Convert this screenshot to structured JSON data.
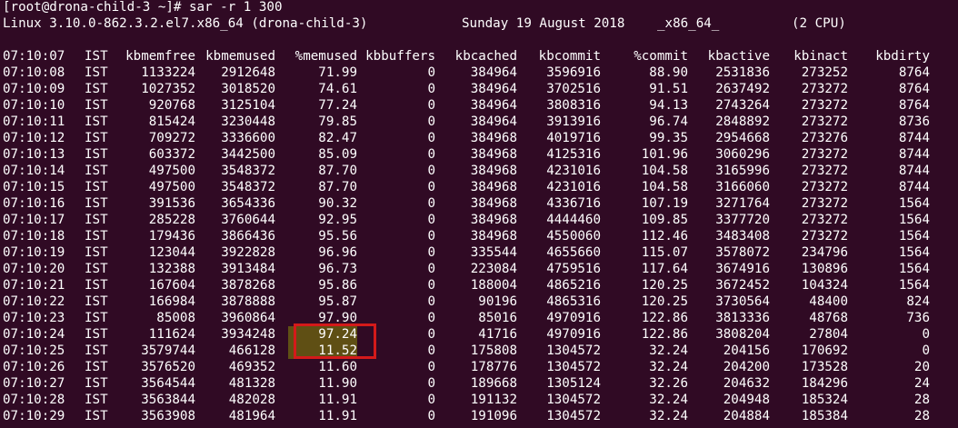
{
  "prompt": "[root@drona-child-3 ~]# sar -r 1 300",
  "sysinfo": {
    "kernel": "Linux 3.10.0-862.3.2.el7.x86_64 (drona-child-3)",
    "date": "Sunday 19 August 2018",
    "arch": "_x86_64_",
    "cpu": "(2 CPU)"
  },
  "header": [
    "07:10:07",
    "IST",
    "kbmemfree",
    "kbmemused",
    "%memused",
    "kbbuffers",
    "kbcached",
    "kbcommit",
    "%commit",
    "kbactive",
    "kbinact",
    "kbdirty"
  ],
  "rows": [
    [
      "07:10:08",
      "IST",
      "1133224",
      "2912648",
      "71.99",
      "0",
      "384964",
      "3596916",
      "88.90",
      "2531836",
      "273252",
      "8764"
    ],
    [
      "07:10:09",
      "IST",
      "1027352",
      "3018520",
      "74.61",
      "0",
      "384964",
      "3702516",
      "91.51",
      "2637492",
      "273272",
      "8764"
    ],
    [
      "07:10:10",
      "IST",
      "920768",
      "3125104",
      "77.24",
      "0",
      "384964",
      "3808316",
      "94.13",
      "2743264",
      "273272",
      "8764"
    ],
    [
      "07:10:11",
      "IST",
      "815424",
      "3230448",
      "79.85",
      "0",
      "384964",
      "3913916",
      "96.74",
      "2848892",
      "273272",
      "8736"
    ],
    [
      "07:10:12",
      "IST",
      "709272",
      "3336600",
      "82.47",
      "0",
      "384968",
      "4019716",
      "99.35",
      "2954668",
      "273276",
      "8744"
    ],
    [
      "07:10:13",
      "IST",
      "603372",
      "3442500",
      "85.09",
      "0",
      "384968",
      "4125316",
      "101.96",
      "3060296",
      "273272",
      "8744"
    ],
    [
      "07:10:14",
      "IST",
      "497500",
      "3548372",
      "87.70",
      "0",
      "384968",
      "4231016",
      "104.58",
      "3165996",
      "273272",
      "8744"
    ],
    [
      "07:10:15",
      "IST",
      "497500",
      "3548372",
      "87.70",
      "0",
      "384968",
      "4231016",
      "104.58",
      "3166060",
      "273272",
      "8744"
    ],
    [
      "07:10:16",
      "IST",
      "391536",
      "3654336",
      "90.32",
      "0",
      "384968",
      "4336716",
      "107.19",
      "3271764",
      "273272",
      "1564"
    ],
    [
      "07:10:17",
      "IST",
      "285228",
      "3760644",
      "92.95",
      "0",
      "384968",
      "4444460",
      "109.85",
      "3377720",
      "273272",
      "1564"
    ],
    [
      "07:10:18",
      "IST",
      "179436",
      "3866436",
      "95.56",
      "0",
      "384968",
      "4550060",
      "112.46",
      "3483408",
      "273272",
      "1564"
    ],
    [
      "07:10:19",
      "IST",
      "123044",
      "3922828",
      "96.96",
      "0",
      "335544",
      "4655660",
      "115.07",
      "3578072",
      "234796",
      "1564"
    ],
    [
      "07:10:20",
      "IST",
      "132388",
      "3913484",
      "96.73",
      "0",
      "223084",
      "4759516",
      "117.64",
      "3674916",
      "130896",
      "1564"
    ],
    [
      "07:10:21",
      "IST",
      "167604",
      "3878268",
      "95.86",
      "0",
      "188004",
      "4865216",
      "120.25",
      "3672452",
      "104324",
      "1564"
    ],
    [
      "07:10:22",
      "IST",
      "166984",
      "3878888",
      "95.87",
      "0",
      "90196",
      "4865316",
      "120.25",
      "3730564",
      "48400",
      "824"
    ],
    [
      "07:10:23",
      "IST",
      "85008",
      "3960864",
      "97.90",
      "0",
      "85016",
      "4970916",
      "122.86",
      "3813336",
      "48768",
      "736"
    ],
    [
      "07:10:24",
      "IST",
      "111624",
      "3934248",
      "97.24",
      "0",
      "41716",
      "4970916",
      "122.86",
      "3808204",
      "27804",
      "0"
    ],
    [
      "07:10:25",
      "IST",
      "3579744",
      "466128",
      "11.52",
      "0",
      "175808",
      "1304572",
      "32.24",
      "204156",
      "170692",
      "0"
    ],
    [
      "07:10:26",
      "IST",
      "3576520",
      "469352",
      "11.60",
      "0",
      "178776",
      "1304572",
      "32.24",
      "204200",
      "173528",
      "20"
    ],
    [
      "07:10:27",
      "IST",
      "3564544",
      "481328",
      "11.90",
      "0",
      "189668",
      "1305124",
      "32.26",
      "204632",
      "184296",
      "24"
    ],
    [
      "07:10:28",
      "IST",
      "3563844",
      "482028",
      "11.91",
      "0",
      "191132",
      "1304572",
      "32.24",
      "204948",
      "185324",
      "28"
    ],
    [
      "07:10:29",
      "IST",
      "3563908",
      "481964",
      "11.91",
      "0",
      "191096",
      "1304572",
      "32.24",
      "204884",
      "185384",
      "28"
    ]
  ],
  "highlighted_rows": [
    16,
    17
  ],
  "colors": {
    "background": "#300a24",
    "text": "#ffffff",
    "highlight_border": "#d41a1a",
    "highlight_fill": "#5f4f14"
  }
}
